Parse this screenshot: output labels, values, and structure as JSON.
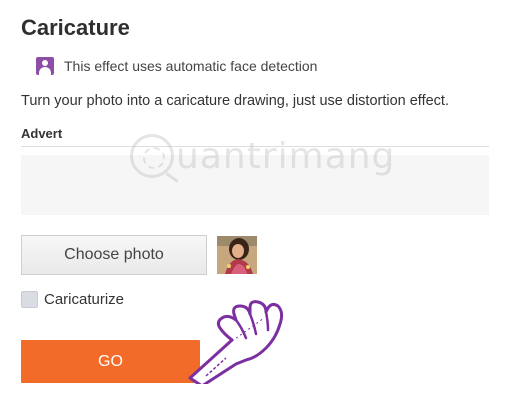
{
  "page": {
    "title": "Caricature",
    "face_detection_note": "This effect uses automatic face detection",
    "description": "Turn your photo into a caricature drawing, just use distortion effect."
  },
  "advert": {
    "label": "Advert"
  },
  "watermark": {
    "text": "uantrimang"
  },
  "upload": {
    "choose_label": "Choose photo"
  },
  "options": {
    "caricaturize_label": "Caricaturize",
    "caricaturize_checked": false
  },
  "actions": {
    "go_label": "GO"
  },
  "colors": {
    "accent": "#f26b29",
    "face_icon": "#8e4ea8",
    "cursor": "#7b2fa0"
  },
  "icons": {
    "face_detection": "person-icon",
    "cursor": "hand-pointer-cursor"
  }
}
